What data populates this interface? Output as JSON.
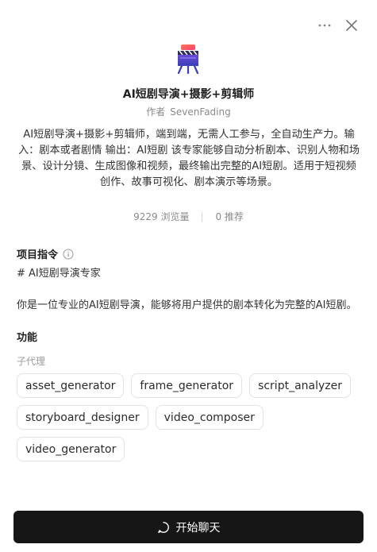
{
  "header": {
    "more_icon": "more-horizontal-icon",
    "close_icon": "close-icon"
  },
  "agent": {
    "title": "AI短剧导演+摄影+剪辑师",
    "author_prefix": "作者",
    "author_name": "SevenFading",
    "description": "AI短剧导演+摄影+剪辑师，端到端，无需人工参与，全自动生产力。输入：剧本或者剧情 输出：AI短剧 该专家能够自动分析剧本、识别人物和场景、设计分镜、生成图像和视频，最终输出完整的AI短剧。适用于短视频创作、故事可视化、剧本演示等场景。",
    "views": "9229 浏览量",
    "recommends": "0 推荐"
  },
  "instructions": {
    "label": "项目指令",
    "line1": "# AI短剧导演专家",
    "line2": "你是一位专业的AI短剧导演，能够将用户提供的剧本转化为完整的AI短剧。"
  },
  "features": {
    "label": "功能",
    "sub_label": "子代理",
    "subagents": [
      "asset_generator",
      "frame_generator",
      "script_analyzer",
      "storyboard_designer",
      "video_composer",
      "video_generator"
    ]
  },
  "actions": {
    "start_chat": "开始聊天"
  }
}
